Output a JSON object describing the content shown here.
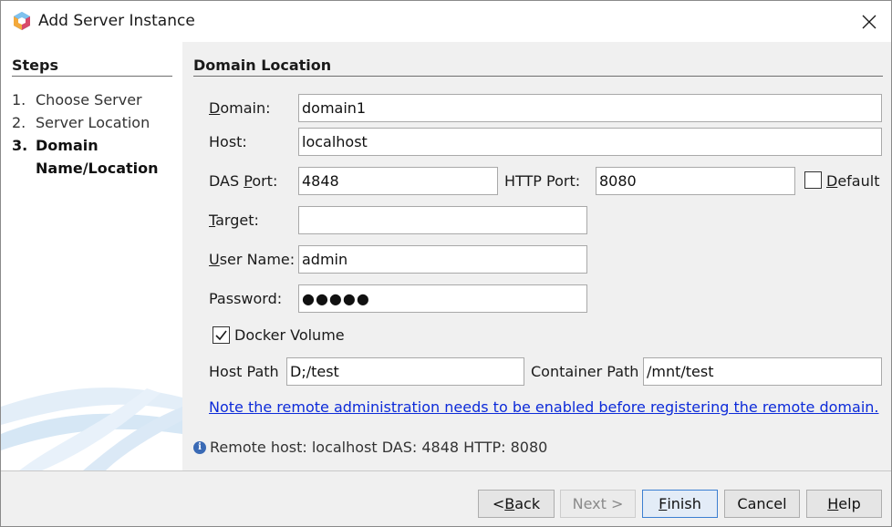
{
  "window": {
    "title": "Add Server Instance",
    "close_glyph": "✕"
  },
  "steps": {
    "title": "Steps",
    "items": [
      {
        "num": "1.",
        "label": "Choose Server"
      },
      {
        "num": "2.",
        "label": "Server Location"
      },
      {
        "num": "3.",
        "label_line1": "Domain",
        "label_line2": "Name/Location"
      }
    ]
  },
  "form": {
    "section_title": "Domain Location",
    "domain_label_key": "D",
    "domain_label_rest": "omain:",
    "domain_value": "domain1",
    "host_label": "Host:",
    "host_value": "localhost",
    "das_port_label_pre": "DAS ",
    "das_port_label_key": "P",
    "das_port_label_rest": "ort:",
    "das_port_value": "4848",
    "http_port_label": "HTTP Port:",
    "http_port_value": "8080",
    "default_label_key": "D",
    "default_label_rest": "efault",
    "default_checked": false,
    "target_label_key": "T",
    "target_label_rest": "arget:",
    "target_value": "",
    "username_label_key": "U",
    "username_label_rest": "ser Name:",
    "username_value": "admin",
    "password_label": "Password:",
    "password_masked": "●●●●●",
    "docker_volume_label": "Docker Volume",
    "docker_volume_checked": true,
    "host_path_label": "Host Path",
    "host_path_value": "D;/test",
    "container_path_label": "Container Path",
    "container_path_value": "/mnt/test",
    "note_link": "Note the remote administration needs to be enabled before registering the remote domain.",
    "info_text": "Remote host: localhost DAS: 4848 HTTP: 8080"
  },
  "buttons": {
    "back_pre": "< ",
    "back_key": "B",
    "back_rest": "ack",
    "next": "Next >",
    "finish_key": "F",
    "finish_rest": "inish",
    "cancel": "Cancel",
    "help_key": "H",
    "help_rest": "elp"
  },
  "colors": {
    "link": "#0d2bd9",
    "accent": "#3c7fd1",
    "info_icon": "#3a6ab5"
  },
  "icons": {
    "app": "netbeans-cube-icon",
    "close": "close-icon",
    "info": "info-icon",
    "check": "checkmark-icon"
  }
}
